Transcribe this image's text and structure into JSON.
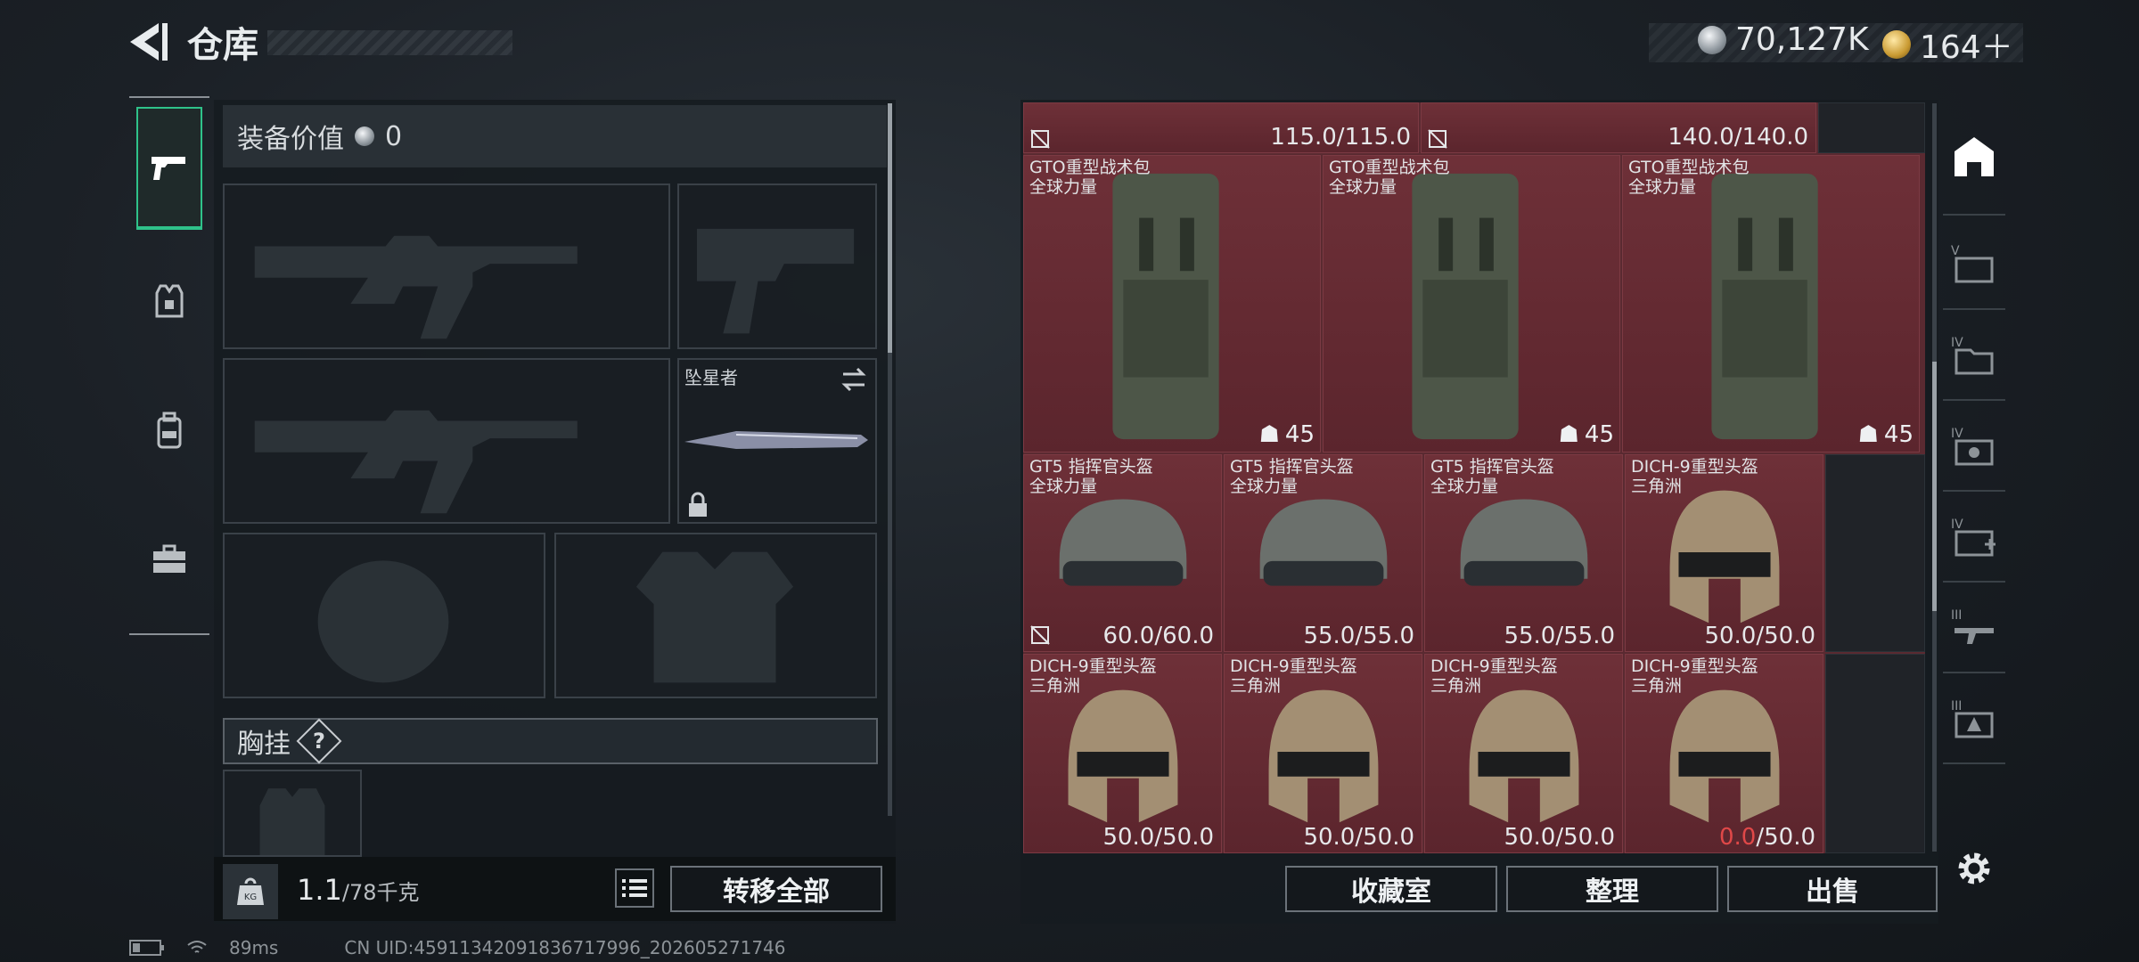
{
  "header": {
    "title": "仓库",
    "currencies": [
      {
        "icon": "silver-coin-icon",
        "value": "70,127K"
      },
      {
        "icon": "gold-coin-icon",
        "value": "164＋"
      }
    ]
  },
  "left_rail": {
    "tabs": [
      {
        "icon": "pistol-icon",
        "active": true
      },
      {
        "icon": "vest-icon",
        "active": false
      },
      {
        "icon": "backpack-icon",
        "active": false
      },
      {
        "icon": "case-icon",
        "active": false
      }
    ]
  },
  "loadout": {
    "equip_value_label": "装备价值",
    "equip_value": "0",
    "knife_label": "坠星者",
    "chest_rig_label": "胸挂",
    "chest_rig_help": "?",
    "weight_value": "1.1",
    "weight_capacity": "/78千克",
    "transfer_all": "转移全部"
  },
  "stash": {
    "top_row": [
      {
        "durability": "115.0/115.0"
      },
      {
        "durability": "140.0/140.0"
      }
    ],
    "backpacks": [
      {
        "name": "GTO重型战术包",
        "faction": "全球力量",
        "level": "45"
      },
      {
        "name": "GTO重型战术包",
        "faction": "全球力量",
        "level": "45"
      },
      {
        "name": "GTO重型战术包",
        "faction": "全球力量",
        "level": "45"
      }
    ],
    "helmets_row1": [
      {
        "name": "GT5 指挥官头盔",
        "faction": "全球力量",
        "durability": "60.0/60.0"
      },
      {
        "name": "GT5 指挥官头盔",
        "faction": "全球力量",
        "durability": "55.0/55.0"
      },
      {
        "name": "GT5 指挥官头盔",
        "faction": "全球力量",
        "durability": "55.0/55.0"
      },
      {
        "name": "DICH-9重型头盔",
        "faction": "三角洲",
        "durability": "50.0/50.0"
      }
    ],
    "helmets_row2": [
      {
        "name": "DICH-9重型头盔",
        "faction": "三角洲",
        "durability": "50.0/50.0"
      },
      {
        "name": "DICH-9重型头盔",
        "faction": "三角洲",
        "durability": "50.0/50.0"
      },
      {
        "name": "DICH-9重型头盔",
        "faction": "三角洲",
        "durability": "50.0/50.0"
      },
      {
        "name": "DICH-9重型头盔",
        "faction": "三角洲",
        "durability_current": "0.0",
        "durability_max": "/50.0"
      }
    ],
    "buttons": {
      "collection": "收藏室",
      "organize": "整理",
      "sell": "出售"
    }
  },
  "right_rail": {
    "categories": [
      "home-icon",
      "tier-v-icon",
      "tier-iv-folder-icon",
      "tier-iv-icon",
      "tier-iv-medkit-icon",
      "tier-iii-weapon-icon",
      "tier-iii-armor-icon",
      "settings-icon"
    ]
  },
  "status_bar": {
    "ping": "89ms",
    "uid": "CN UID:459113420918367179​96_202605271746"
  },
  "colors": {
    "accent": "#2fc28a",
    "item_bg": "#6e3038",
    "warning": "#e04848"
  }
}
